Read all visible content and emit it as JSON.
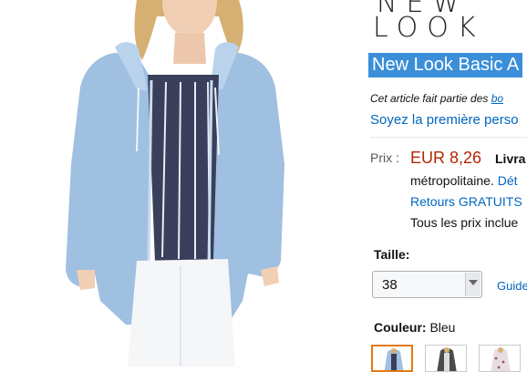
{
  "brand": {
    "logo_line1": "NEW",
    "logo_line2": "LOOK"
  },
  "product": {
    "title": "New Look Basic A",
    "series_prefix": "Cet article fait partie des ",
    "series_link": "bo",
    "review_prompt": "Soyez la première perso"
  },
  "price": {
    "label": "Prix :",
    "value": "EUR 8,26",
    "delivery_word": "Livra",
    "metro_text": "métropolitaine. ",
    "details_link": "Dét",
    "returns": "Retours GRATUITS",
    "tax_note": "Tous les prix inclue"
  },
  "size": {
    "label": "Taille:",
    "selected": "38",
    "guide_link": "Guide"
  },
  "color": {
    "label": "Couleur:",
    "value": " Bleu"
  },
  "colors": {
    "accent_orange": "#e47911",
    "link_blue": "#0066c0",
    "price_red": "#b12704",
    "title_highlight": "#3b8fd8"
  },
  "icons": {
    "select_arrow": "chevron-down-icon"
  }
}
